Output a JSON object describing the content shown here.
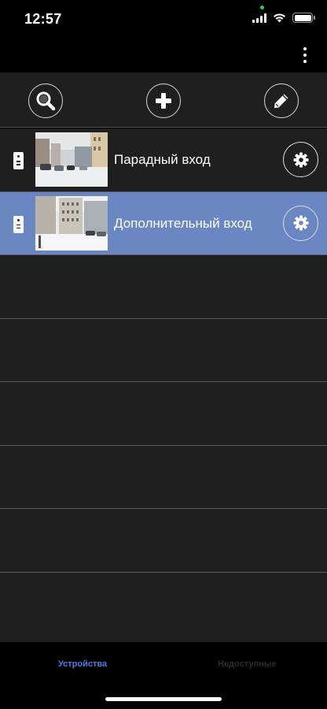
{
  "status_bar": {
    "time": "12:57",
    "icons": [
      "cellular-signal-icon",
      "wifi-icon",
      "battery-icon"
    ]
  },
  "top_bar": {
    "menu_icon": "more-vertical-icon"
  },
  "toolbar": {
    "buttons": [
      {
        "name": "search-button",
        "icon": "magnifier-icon"
      },
      {
        "name": "add-button",
        "icon": "plus-icon"
      },
      {
        "name": "edit-button",
        "icon": "pencil-icon"
      }
    ]
  },
  "devices": [
    {
      "label": "Парадный вход",
      "selected": false,
      "icon": "intercom-icon",
      "settings_icon": "gear-icon"
    },
    {
      "label": "Дополнительный вход",
      "selected": true,
      "icon": "intercom-icon",
      "settings_icon": "gear-icon"
    }
  ],
  "empty_rows": 6,
  "tabs": [
    {
      "label": "Устройства",
      "active": true
    },
    {
      "label": "Недоступные",
      "active": false
    }
  ],
  "colors": {
    "background": "#1f1f1f",
    "selected_row": "#6a87c4",
    "active_tab": "#4d7ce0",
    "inactive_tab": "#2c2c2c"
  }
}
